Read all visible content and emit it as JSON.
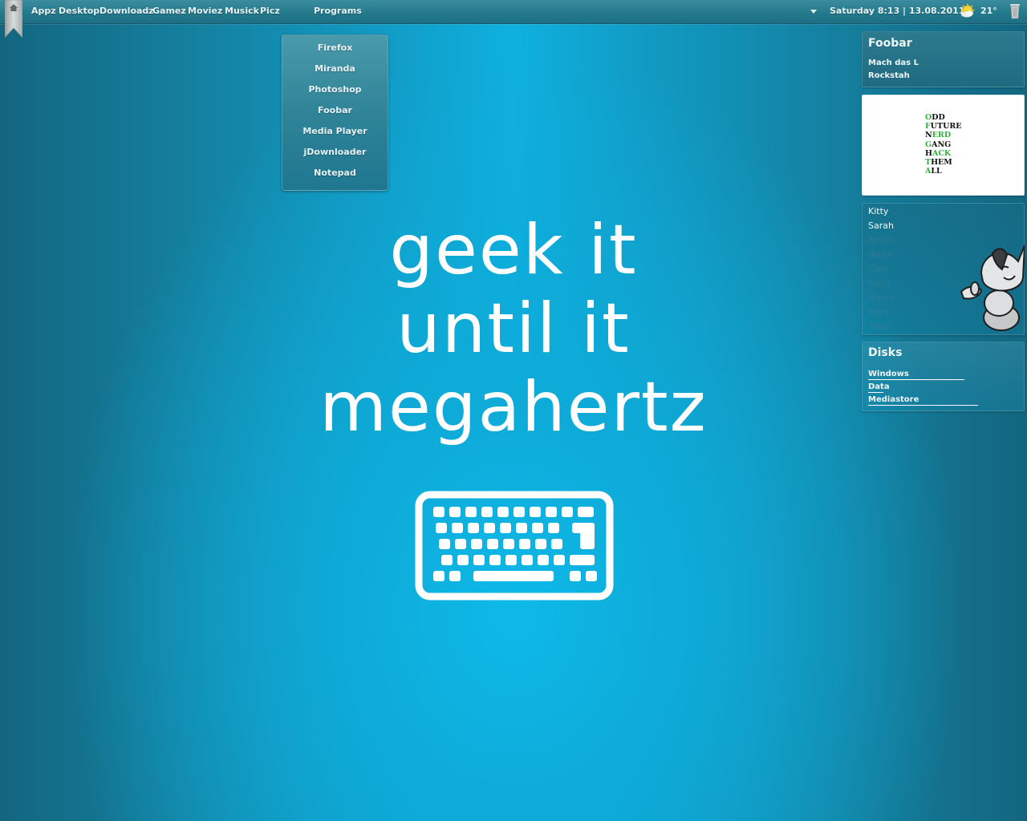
{
  "topbar": {
    "home_icon": "home-ribbon-icon",
    "menu": [
      "Appz",
      "Desktop",
      "Downloadz",
      "Gamez",
      "Moviez",
      "Musick",
      "Picz"
    ],
    "programs_label": "Programs",
    "clock": "Saturday 8:13 | 13.08.2011",
    "weather_icon": "partly-sunny-icon",
    "temperature": "21°",
    "trash_icon": "trash-icon"
  },
  "programs_menu": {
    "items": [
      "Firefox",
      "Miranda",
      "Photoshop",
      "Foobar",
      "Media Player",
      "jDownloader",
      "Notepad"
    ]
  },
  "widgets": {
    "foobar": {
      "title": "Foobar",
      "track": "Mach das L",
      "artist": "Rockstah"
    },
    "image": {
      "lines": [
        {
          "first": "O",
          "rest": "DD",
          "rest_green": false
        },
        {
          "first": "F",
          "rest": "UTURE",
          "rest_green": false
        },
        {
          "first": "N",
          "rest": "ERD",
          "rest_green": true
        },
        {
          "first": "G",
          "rest": "ANG",
          "rest_green": false
        },
        {
          "first": "H",
          "rest": "ACK",
          "rest_green": true
        },
        {
          "first": "T",
          "rest": "HEM",
          "rest_green": false
        },
        {
          "first": "A",
          "rest": "LL",
          "rest_green": false
        }
      ]
    },
    "contacts": {
      "online": [
        "Kitty",
        "Sarah"
      ],
      "offline": [
        "André",
        "Biene",
        "Calli",
        "Ernst",
        "Marco",
        "Marv",
        "Toast"
      ]
    },
    "disks": {
      "title": "Disks",
      "items": [
        {
          "name": "Windows",
          "usage": 0.63
        },
        {
          "name": "Data",
          "usage": 0.1
        },
        {
          "name": "Mediastore",
          "usage": 0.72
        }
      ]
    }
  },
  "wallpaper": {
    "lines": [
      "geek it",
      "until it",
      "megahertz"
    ],
    "icon": "keyboard-icon"
  },
  "colors": {
    "accent_green": "#2eb33a",
    "bg_center": "#0fb0df",
    "bg_edge": "#136680"
  }
}
